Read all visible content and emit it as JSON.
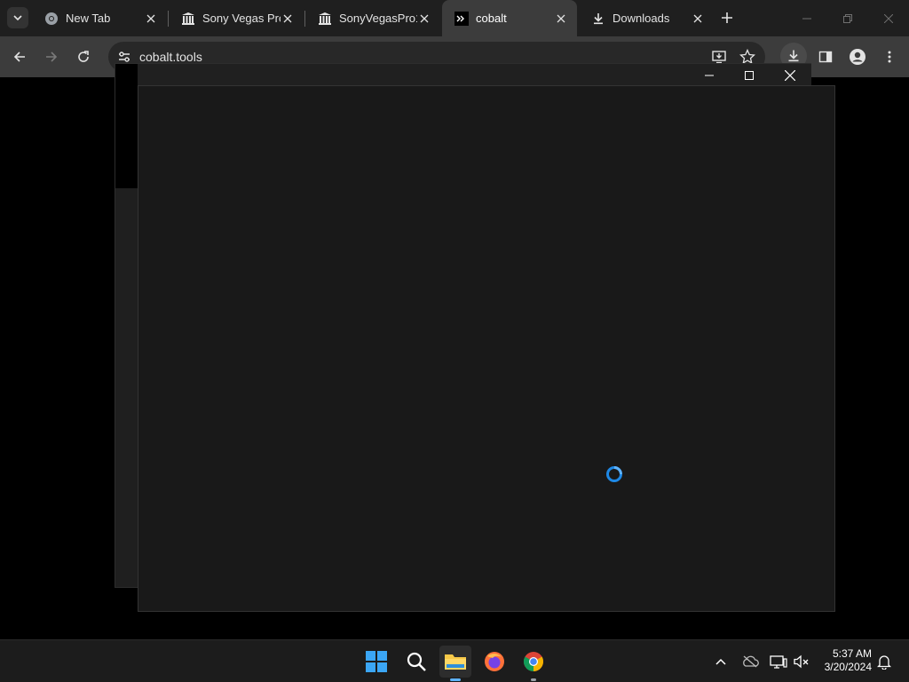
{
  "tabs": [
    {
      "title": "New Tab",
      "favicon": "chrome-icon"
    },
    {
      "title": "Sony Vegas Pro",
      "favicon": "library-icon"
    },
    {
      "title": "SonyVegasPro1",
      "favicon": "library-icon"
    },
    {
      "title": "cobalt",
      "favicon": "cobalt-icon",
      "active": true
    },
    {
      "title": "Downloads",
      "favicon": "download-icon"
    }
  ],
  "address_bar": {
    "url": "cobalt.tools"
  },
  "taskbar": {
    "apps": [
      "windows-start",
      "search",
      "file-explorer",
      "firefox",
      "chrome"
    ],
    "time": "5:37 AM",
    "date": "3/20/2024"
  },
  "colors": {
    "accent": "#1e88e5",
    "tab_strip": "#1f1f1f",
    "toolbar": "#3c3c3c",
    "dialog": "#191919"
  }
}
